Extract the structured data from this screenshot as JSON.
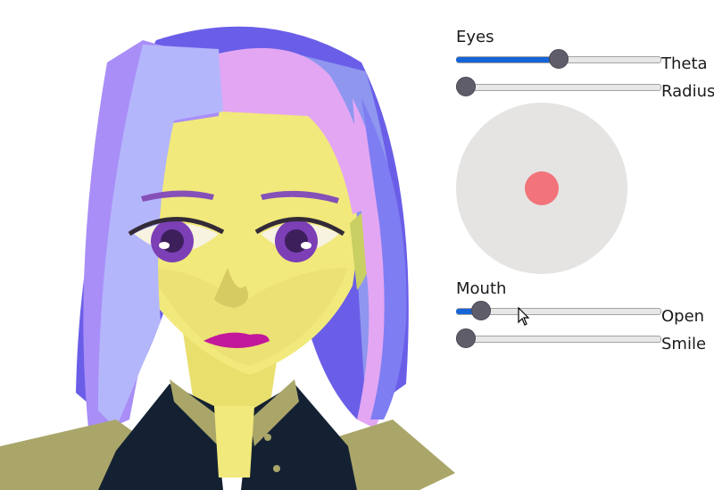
{
  "eyes": {
    "heading": "Eyes",
    "theta": {
      "label": "Theta",
      "value": 0.5
    },
    "radius": {
      "label": "Radius",
      "value": 0.0
    },
    "gaze_x": 0.0,
    "gaze_y": 0.0
  },
  "mouth": {
    "heading": "Mouth",
    "open": {
      "label": "Open",
      "value": 0.08
    },
    "smile": {
      "label": "Smile",
      "value": 0.0
    }
  },
  "colors": {
    "slider_fill": "#1565d8",
    "thumb": "#5f5d69",
    "joystick_bg": "#e5e4e3",
    "joystick_dot": "#f2737a",
    "skin": "#f1e97b",
    "hair_purple": "#8b86ee",
    "hair_pink": "#e3a6f3",
    "iris": "#7c3fb6",
    "lips": "#c2189b",
    "uniform": "#142132",
    "epaulette": "#aaa66a"
  }
}
